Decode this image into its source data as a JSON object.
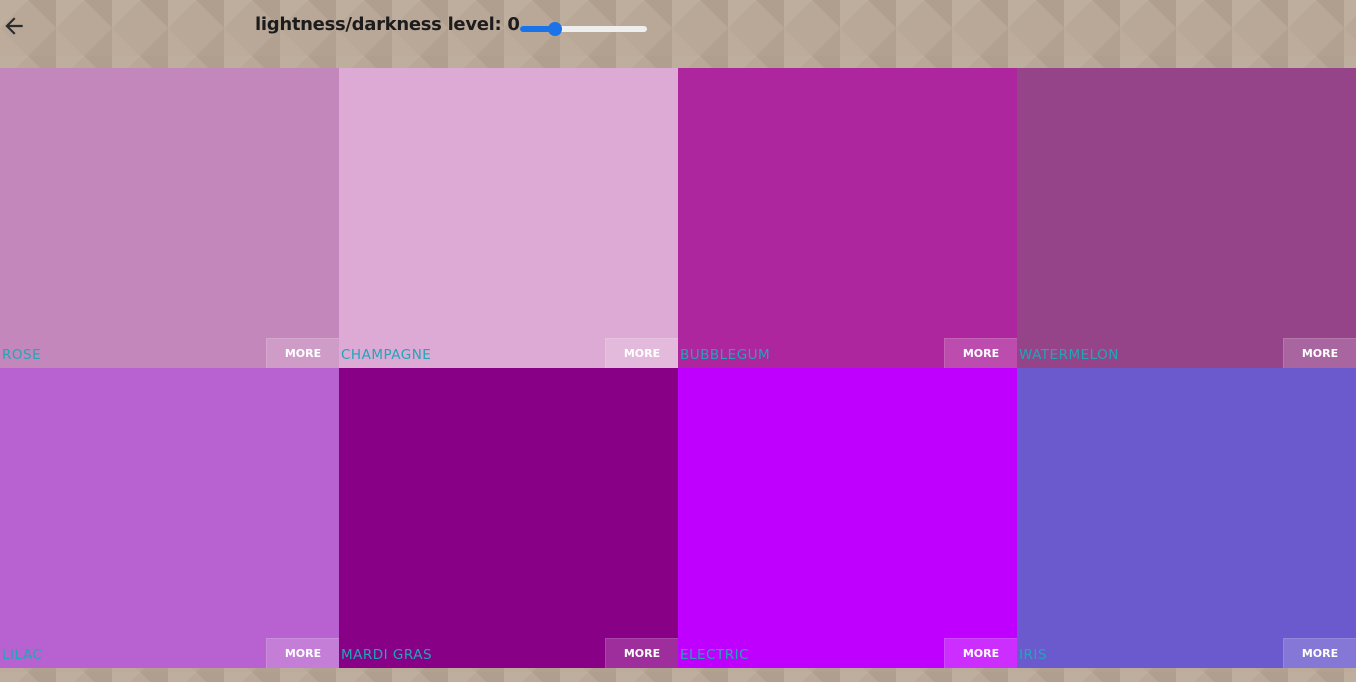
{
  "header": {
    "back_icon": "arrow-left-icon",
    "level_text": "lightness/darkness level: 0",
    "slider": {
      "value": 0,
      "min": -50,
      "max": 50,
      "accent": "#1a73e8"
    }
  },
  "palette": [
    {
      "name": "ROSE",
      "color": "#c487bb",
      "more_label": "MORE"
    },
    {
      "name": "CHAMPAGNE",
      "color": "#ddaad5",
      "more_label": "MORE"
    },
    {
      "name": "BUBBLEGUM",
      "color": "#ae269e",
      "more_label": "MORE"
    },
    {
      "name": "WATERMELON",
      "color": "#96448a",
      "more_label": "MORE"
    },
    {
      "name": "LILAC",
      "color": "#b762d0",
      "more_label": "MORE"
    },
    {
      "name": "MARDI GRAS",
      "color": "#880085",
      "more_label": "MORE"
    },
    {
      "name": "ELECTRIC",
      "color": "#c000ff",
      "more_label": "MORE"
    },
    {
      "name": "IRIS",
      "color": "#6b5acd",
      "more_label": "MORE"
    }
  ]
}
